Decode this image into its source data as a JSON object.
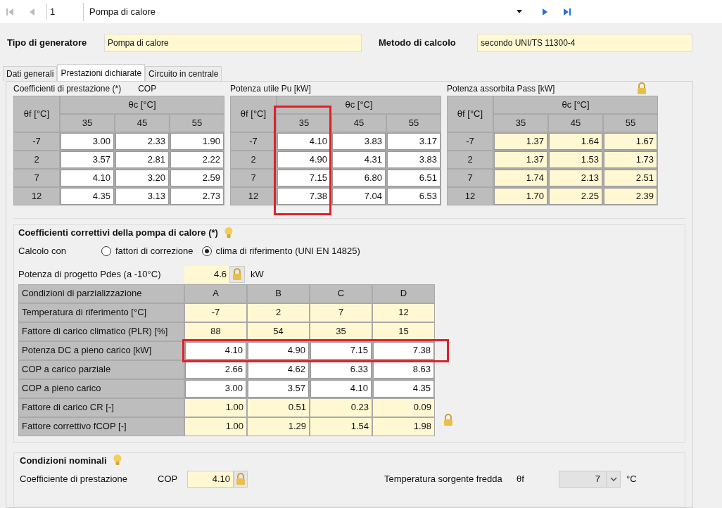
{
  "toolbar": {
    "record": "1",
    "selector": "Pompa di calore"
  },
  "header": {
    "fields": [
      {
        "label": "Tipo di generatore",
        "value": "Pompa di calore"
      },
      {
        "label": "Metodo di calcolo",
        "value": "secondo UNI/TS 11300-4"
      }
    ]
  },
  "tabs": [
    {
      "label": "Dati generali",
      "selected": false
    },
    {
      "label": "Prestazioni dichiarate",
      "selected": true
    },
    {
      "label": "Circuito in centrale",
      "selected": false
    }
  ],
  "performance_tables": [
    {
      "title": "Coefficienti di prestazione (*)",
      "unit": "COP",
      "editable": true,
      "locked": false,
      "row_header": "θf [°C]",
      "group_header": "θc [°C]",
      "columns": [
        {
          "label": "35",
          "highlighted": false
        },
        {
          "label": "45",
          "highlighted": false
        },
        {
          "label": "55",
          "highlighted": false
        }
      ],
      "rows": [
        {
          "label": "-7",
          "values": [
            "3.00",
            "2.33",
            "1.90"
          ]
        },
        {
          "label": "2",
          "values": [
            "3.57",
            "2.81",
            "2.22"
          ]
        },
        {
          "label": "7",
          "values": [
            "4.10",
            "3.20",
            "2.59"
          ]
        },
        {
          "label": "12",
          "values": [
            "4.35",
            "3.13",
            "2.73"
          ]
        }
      ]
    },
    {
      "title": "Potenza utile Pu [kW]",
      "editable": true,
      "locked": false,
      "row_header": "θf [°C]",
      "group_header": "θc [°C]",
      "columns": [
        {
          "label": "35",
          "highlighted": true
        },
        {
          "label": "45",
          "highlighted": false
        },
        {
          "label": "55",
          "highlighted": false
        }
      ],
      "rows": [
        {
          "label": "-7",
          "values": [
            "4.10",
            "3.83",
            "3.17"
          ]
        },
        {
          "label": "2",
          "values": [
            "4.90",
            "4.31",
            "3.83"
          ]
        },
        {
          "label": "7",
          "values": [
            "7.15",
            "6.80",
            "6.51"
          ]
        },
        {
          "label": "12",
          "values": [
            "7.38",
            "7.04",
            "6.53"
          ]
        }
      ]
    },
    {
      "title": "Potenza assorbita Pass [kW]",
      "editable": false,
      "locked": true,
      "row_header": "θf [°C]",
      "group_header": "θc [°C]",
      "columns": [
        {
          "label": "35",
          "highlighted": false
        },
        {
          "label": "45",
          "highlighted": false
        },
        {
          "label": "55",
          "highlighted": false
        }
      ],
      "rows": [
        {
          "label": "-7",
          "values": [
            "1.37",
            "1.64",
            "1.67"
          ]
        },
        {
          "label": "2",
          "values": [
            "1.37",
            "1.53",
            "1.73"
          ]
        },
        {
          "label": "7",
          "values": [
            "1.74",
            "2.13",
            "2.51"
          ]
        },
        {
          "label": "12",
          "values": [
            "1.70",
            "2.25",
            "2.39"
          ]
        }
      ]
    }
  ],
  "correction": {
    "title": "Coefficienti correttivi della pompa di calore (*)",
    "calc_label": "Calcolo con",
    "options": [
      {
        "label": "fattori di correzione",
        "selected": false
      },
      {
        "label": "clima di riferimento (UNI EN 14825)",
        "selected": true
      }
    ],
    "design_power": {
      "label": "Potenza di progetto Pdes (a -10°C)",
      "value": "4.6",
      "unit": "kW",
      "locked": true
    },
    "columns": [
      "Condizioni di parzializzazione",
      "A",
      "B",
      "C",
      "D"
    ],
    "rows": [
      {
        "label": "Temperatura di riferimento [°C]",
        "kind": "centered",
        "editable": false,
        "highlighted": false,
        "values": [
          "-7",
          "2",
          "7",
          "12"
        ]
      },
      {
        "label": "Fattore di carico climatico (PLR) [%]",
        "kind": "centered",
        "editable": false,
        "highlighted": false,
        "values": [
          "88",
          "54",
          "35",
          "15"
        ]
      },
      {
        "label": "Potenza DC a pieno carico [kW]",
        "kind": "number",
        "editable": true,
        "highlighted": true,
        "values": [
          "4.10",
          "4.90",
          "7.15",
          "7.38"
        ]
      },
      {
        "label": "COP a carico parziale",
        "kind": "number",
        "editable": true,
        "highlighted": false,
        "values": [
          "2.66",
          "4.62",
          "6.33",
          "8.63"
        ]
      },
      {
        "label": "COP a pieno carico",
        "kind": "number",
        "editable": true,
        "highlighted": false,
        "values": [
          "3.00",
          "3.57",
          "4.10",
          "4.35"
        ]
      },
      {
        "label": "Fattore di carico CR [-]",
        "kind": "number",
        "editable": false,
        "highlighted": false,
        "values": [
          "1.00",
          "0.51",
          "0.23",
          "0.09"
        ]
      },
      {
        "label": "Fattore correttivo fCOP [-]",
        "kind": "number",
        "editable": false,
        "highlighted": false,
        "values": [
          "1.00",
          "1.29",
          "1.54",
          "1.98"
        ]
      }
    ],
    "locked": true
  },
  "nominal": {
    "title": "Condizioni nominali",
    "left": {
      "label": "Coefficiente di prestazione",
      "symbol": "COP",
      "value": "4.10",
      "locked": true
    },
    "right": {
      "label": "Temperatura sorgente fredda",
      "symbol": "θf",
      "value": "7",
      "unit": "°C",
      "disabled": true
    }
  }
}
